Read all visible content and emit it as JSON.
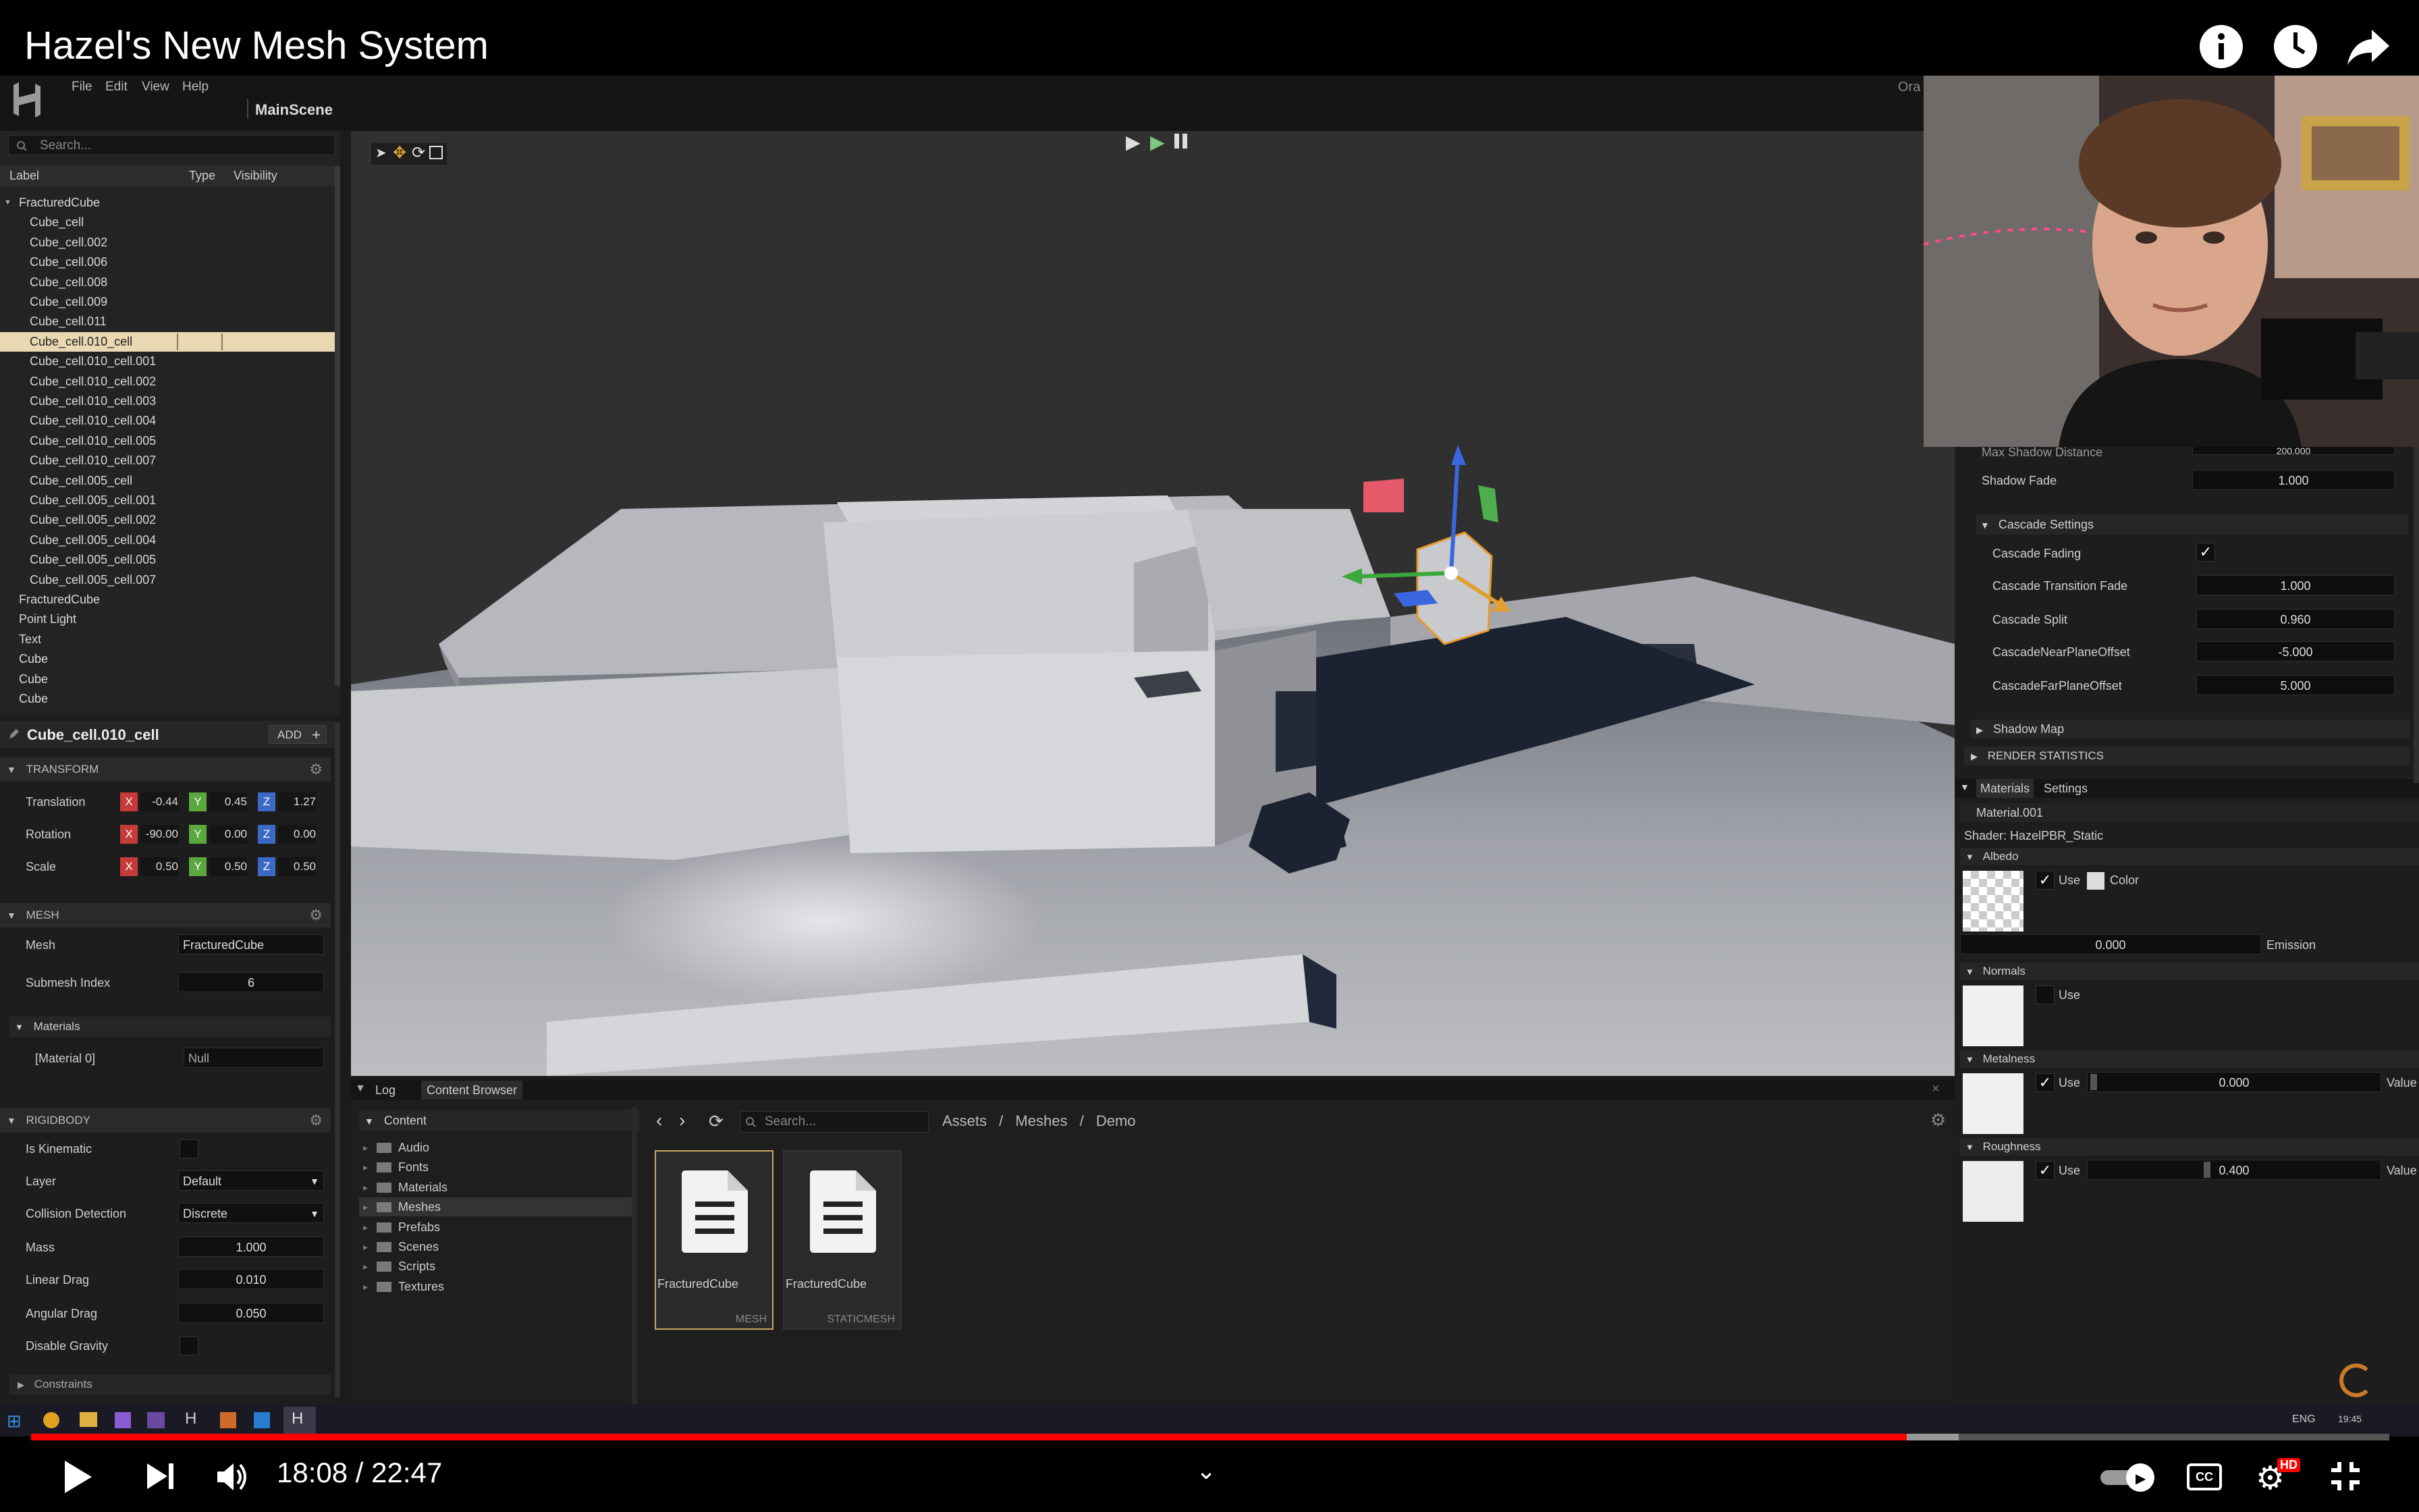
{
  "video": {
    "title": "Hazel's New Mesh System",
    "current_time": "18:08",
    "duration": "22:47",
    "progress": 0.7954,
    "buffered": 0.8175,
    "hd_badge": "HD",
    "progress_color": "#ff0000"
  },
  "editor": {
    "menu": [
      "File",
      "Edit",
      "View",
      "Help"
    ],
    "scene_name": "MainScene",
    "right_clipped_text": "Ora",
    "hierarchy": {
      "search_placeholder": "Search...",
      "columns": [
        "Label",
        "Type",
        "Visibility"
      ],
      "items": [
        {
          "label": "FracturedCube",
          "indent": 0,
          "expanded": true
        },
        {
          "label": "Cube_cell",
          "indent": 1
        },
        {
          "label": "Cube_cell.002",
          "indent": 1
        },
        {
          "label": "Cube_cell.006",
          "indent": 1
        },
        {
          "label": "Cube_cell.008",
          "indent": 1
        },
        {
          "label": "Cube_cell.009",
          "indent": 1
        },
        {
          "label": "Cube_cell.011",
          "indent": 1
        },
        {
          "label": "Cube_cell.010_cell",
          "indent": 1,
          "selected": true
        },
        {
          "label": "Cube_cell.010_cell.001",
          "indent": 1
        },
        {
          "label": "Cube_cell.010_cell.002",
          "indent": 1
        },
        {
          "label": "Cube_cell.010_cell.003",
          "indent": 1
        },
        {
          "label": "Cube_cell.010_cell.004",
          "indent": 1
        },
        {
          "label": "Cube_cell.010_cell.005",
          "indent": 1
        },
        {
          "label": "Cube_cell.010_cell.007",
          "indent": 1
        },
        {
          "label": "Cube_cell.005_cell",
          "indent": 1
        },
        {
          "label": "Cube_cell.005_cell.001",
          "indent": 1
        },
        {
          "label": "Cube_cell.005_cell.002",
          "indent": 1
        },
        {
          "label": "Cube_cell.005_cell.004",
          "indent": 1
        },
        {
          "label": "Cube_cell.005_cell.005",
          "indent": 1
        },
        {
          "label": "Cube_cell.005_cell.007",
          "indent": 1
        },
        {
          "label": "FracturedCube",
          "indent": 0
        },
        {
          "label": "Point Light",
          "indent": 0
        },
        {
          "label": "Text",
          "indent": 0
        },
        {
          "label": "Cube",
          "indent": 0
        },
        {
          "label": "Cube",
          "indent": 0
        },
        {
          "label": "Cube",
          "indent": 0
        }
      ]
    },
    "properties": {
      "entity_name": "Cube_cell.010_cell",
      "add_label": "ADD",
      "transform": {
        "title": "TRANSFORM",
        "rows": [
          {
            "label": "Translation",
            "x": "-0.44",
            "y": "0.45",
            "z": "1.27"
          },
          {
            "label": "Rotation",
            "x": "-90.00",
            "y": "0.00",
            "z": "0.00"
          },
          {
            "label": "Scale",
            "x": "0.50",
            "y": "0.50",
            "z": "0.50"
          }
        ]
      },
      "mesh": {
        "title": "MESH",
        "mesh_label": "Mesh",
        "mesh_value": "FracturedCube",
        "submesh_label": "Submesh Index",
        "submesh_value": "6",
        "materials_label": "Materials",
        "material0_label": "[Material 0]",
        "material0_value": "Null"
      },
      "rigidbody": {
        "title": "RIGIDBODY",
        "is_kinematic": "Is Kinematic",
        "layer_label": "Layer",
        "layer_value": "Default",
        "collision_label": "Collision Detection",
        "collision_value": "Discrete",
        "mass_label": "Mass",
        "mass_value": "1.000",
        "linear_drag_label": "Linear Drag",
        "linear_drag_value": "0.010",
        "angular_drag_label": "Angular Drag",
        "angular_drag_value": "0.050",
        "disable_gravity_label": "Disable Gravity",
        "constraints_label": "Constraints"
      }
    },
    "bottom": {
      "tabs": [
        "Log",
        "Content Browser"
      ],
      "tree_root": "Content",
      "folders": [
        "Audio",
        "Fonts",
        "Materials",
        "Meshes",
        "Prefabs",
        "Scenes",
        "Scripts",
        "Textures"
      ],
      "selected_folder": "Meshes",
      "search_placeholder": "Search...",
      "breadcrumb": [
        "Assets",
        "Meshes",
        "Demo"
      ],
      "breadcrumb_sep": "/",
      "assets": [
        {
          "name": "FracturedCube",
          "type": "MESH",
          "selected": true
        },
        {
          "name": "FracturedCube",
          "type": "STATICMESH"
        }
      ]
    },
    "right_panel": {
      "max_shadow_distance_label": "Max Shadow Distance",
      "max_shadow_distance_value": "200.000",
      "shadow_fade_label": "Shadow Fade",
      "shadow_fade_value": "1.000",
      "cascade_settings": "Cascade Settings",
      "cascade_fading": "Cascade Fading",
      "cascade_transition_fade_label": "Cascade Transition Fade",
      "cascade_transition_fade_value": "1.000",
      "cascade_split_label": "Cascade Split",
      "cascade_split_value": "0.960",
      "near_plane_label": "CascadeNearPlaneOffset",
      "near_plane_value": "-5.000",
      "far_plane_label": "CascadeFarPlaneOffset",
      "far_plane_value": "5.000",
      "shadow_map": "Shadow Map",
      "render_statistics": "RENDER STATISTICS",
      "tabs": [
        "Materials",
        "Settings"
      ],
      "material_name": "Material.001",
      "shader": "Shader: HazelPBR_Static",
      "albedo": "Albedo",
      "use_label": "Use",
      "color_label": "Color",
      "emission_value": "0.000",
      "emission_label": "Emission",
      "normals": "Normals",
      "metalness": "Metalness",
      "metalness_value": "0.000",
      "value_label": "Value",
      "roughness": "Roughness",
      "roughness_value": "0.400"
    },
    "taskbar": {
      "lang": "ENG",
      "clock": "19:45"
    }
  }
}
